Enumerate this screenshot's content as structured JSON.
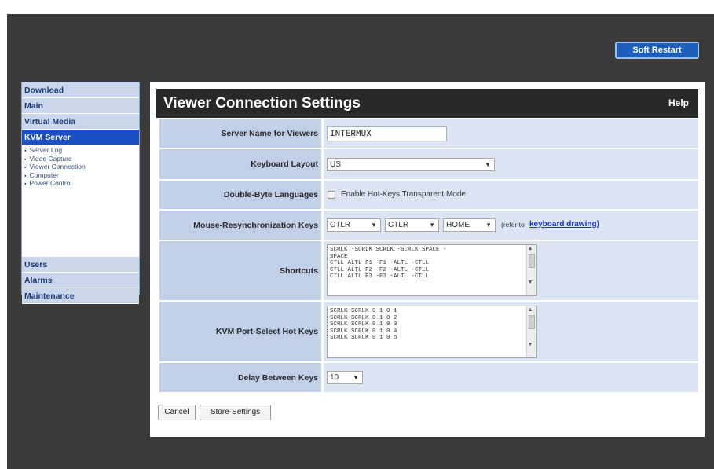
{
  "header": {
    "soft_restart": "Soft Restart"
  },
  "sidebar": {
    "top_items": [
      "Download",
      "Main",
      "Virtual Media"
    ],
    "active": "KVM Server",
    "sub_items": [
      "Server Log",
      "Video Capture",
      "Viewer Connection",
      "Computer",
      "Power Control"
    ],
    "bottom_items": [
      "Users",
      "Alarms",
      "Maintenance"
    ]
  },
  "page": {
    "title": "Viewer Connection Settings",
    "help": "Help"
  },
  "form": {
    "server_name": {
      "label": "Server Name for Viewers",
      "value": "INTERMUX"
    },
    "keyboard_layout": {
      "label": "Keyboard Layout",
      "value": "US"
    },
    "double_byte": {
      "label": "Double-Byte Languages",
      "checkbox_label": "Enable Hot-Keys Transparent Mode",
      "checked": false
    },
    "mouse_resync": {
      "label": "Mouse-Resynchronization Keys",
      "key1": "CTLR",
      "key2": "CTLR",
      "key3": "HOME",
      "note": "(refer to",
      "link": "keyboard drawing)"
    },
    "shortcuts": {
      "label": "Shortcuts",
      "lines": [
        "SCRLK -SCRLK SCRLK -SCRLK SPACE -",
        "SPACE",
        "CTLL ALTL F1 -F1 -ALTL -CTLL",
        "CTLL ALTL F2 -F2 -ALTL -CTLL",
        "CTLL ALTL F3 -F3 -ALTL -CTLL"
      ]
    },
    "port_select": {
      "label": "KVM Port-Select Hot Keys",
      "lines": [
        "SCRLK SCRLK 0 1 0 1",
        "SCRLK SCRLK 0 1 0 2",
        "SCRLK SCRLK 0 1 0 3",
        "SCRLK SCRLK 0 1 0 4",
        "SCRLK SCRLK 0 1 0 5"
      ]
    },
    "delay": {
      "label": "Delay Between Keys",
      "value": "10"
    }
  },
  "buttons": {
    "cancel": "Cancel",
    "store": "Store-Settings"
  }
}
